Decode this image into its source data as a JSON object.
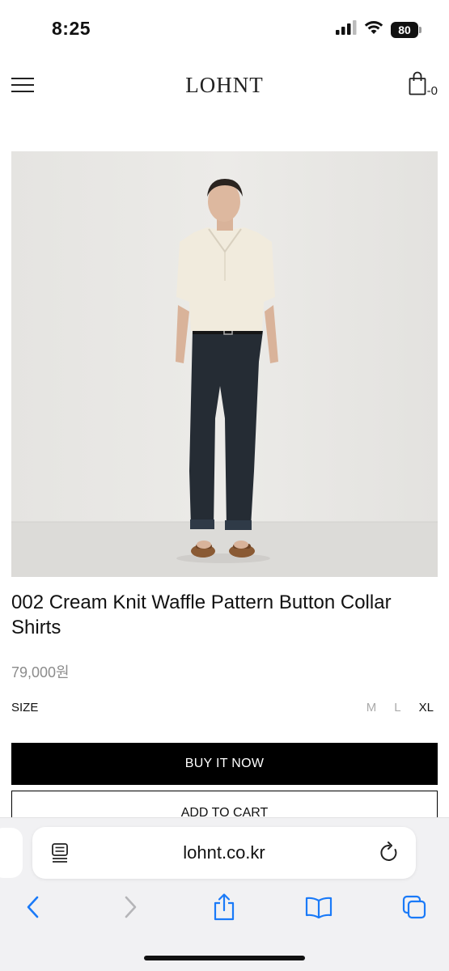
{
  "status_bar": {
    "time": "8:25",
    "battery": "80",
    "icons": [
      "cellular-signal-icon",
      "wifi-icon",
      "battery-icon"
    ]
  },
  "header": {
    "brand": "LOHNT",
    "cart_count": "-0",
    "icons": [
      "hamburger-menu-icon",
      "shopping-bag-icon"
    ]
  },
  "product": {
    "title": "002 Cream Knit Waffle Pattern Button Collar Shirts",
    "price": "79,000원",
    "size_label": "SIZE",
    "sizes": [
      "M",
      "L",
      "XL"
    ],
    "selected_size": "XL",
    "buy_now_label": "BUY IT NOW",
    "add_to_cart_label": "ADD TO CART"
  },
  "browser": {
    "url": "lohnt.co.kr",
    "icons": [
      "reader-mode-icon",
      "reload-icon",
      "back-icon",
      "forward-icon",
      "share-icon",
      "bookmarks-icon",
      "tabs-icon"
    ]
  },
  "colors": {
    "accent": "#1a7af8",
    "button_dark": "#000000",
    "price_gray": "#8c8c8c"
  }
}
